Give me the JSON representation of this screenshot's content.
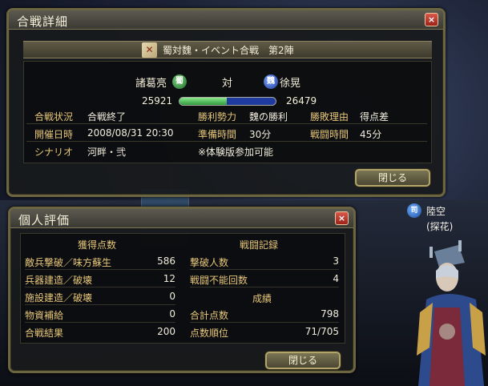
{
  "battle_window": {
    "title": "合戦詳細",
    "close_icon": "×",
    "battle_name": "蜀対魏・イベント合戦　第2陣",
    "side_left_name": "諸葛亮",
    "side_left_badge": "蜀",
    "versus": "対",
    "side_right_badge": "魏",
    "side_right_name": "徐晃",
    "score_left": "25921",
    "score_right": "26479",
    "score_share_left": 0.495,
    "info": {
      "status_label": "合戦状況",
      "status_value": "合戦終了",
      "winner_label": "勝利勢力",
      "winner_value": "魏の勝利",
      "reason_label": "勝敗理由",
      "reason_value": "得点差",
      "date_label": "開催日時",
      "date_value": "2008/08/31 20:30",
      "prep_label": "準備時間",
      "prep_value": "30分",
      "battle_time_label": "戦闘時間",
      "battle_time_value": "45分",
      "scenario_label": "シナリオ",
      "scenario_value": "河畔・弐",
      "note": "※体験版参加可能"
    },
    "close_button": "閉じる"
  },
  "personal_window": {
    "title": "個人評価",
    "close_icon": "×",
    "left_header": "獲得点数",
    "right_header": "戦闘記録",
    "right_sub_header": "成績",
    "left_rows": [
      {
        "label": "敵兵撃破／味方蘇生",
        "value": "586"
      },
      {
        "label": "兵器建造／破壊",
        "value": "12"
      },
      {
        "label": "施設建造／破壊",
        "value": "0"
      },
      {
        "label": "物資補給",
        "value": "0"
      },
      {
        "label": "合戦結果",
        "value": "200"
      }
    ],
    "right_rows": [
      {
        "label": "撃破人数",
        "value": "3"
      },
      {
        "label": "戦闘不能回数",
        "value": "4"
      }
    ],
    "right_result_rows": [
      {
        "label": "合計点数",
        "value": "798"
      },
      {
        "label": "点数順位",
        "value": "71/705"
      }
    ],
    "close_button": "閉じる"
  },
  "character": {
    "badge": "司",
    "name": "陸空",
    "tag": "(探花)"
  },
  "colors": {
    "frame": "#6b6542",
    "label_gold": "#e6c77a",
    "text": "#f0ecdc",
    "close_red": "#c0392b",
    "shu_green": "#2e9a3e",
    "wei_blue": "#1f3ba0"
  }
}
